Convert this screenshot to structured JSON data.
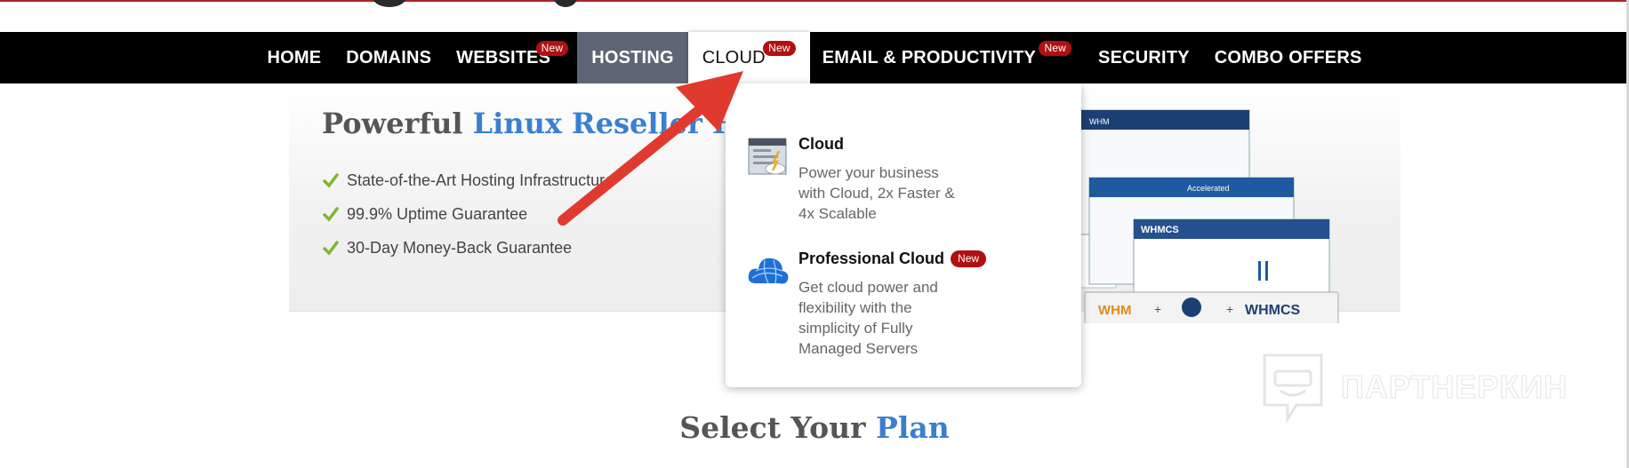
{
  "nav": {
    "items": [
      {
        "label": "HOME"
      },
      {
        "label": "DOMAINS"
      },
      {
        "label": "WEBSITES",
        "badge": "New"
      },
      {
        "label": "HOSTING"
      },
      {
        "label": "CLOUD",
        "badge": "New"
      },
      {
        "label": "EMAIL & PRODUCTIVITY",
        "badge": "New"
      },
      {
        "label": "SECURITY"
      },
      {
        "label": "COMBO OFFERS"
      }
    ]
  },
  "hero": {
    "title_plain": "Powerful ",
    "title_accent": "Linux Reseller Ho",
    "features": [
      "State-of-the-Art Hosting Infrastructure",
      "99.9% Uptime Guarantee",
      "30-Day Money-Back Guarantee"
    ],
    "brands": [
      "WHM",
      "WHMCS",
      "Accelerated",
      "WHMCS",
      "+",
      "+",
      "WHMCS"
    ]
  },
  "dropdown": {
    "items": [
      {
        "title": "Cloud",
        "description": "Power your business with Cloud, 2x Faster & 4x Scalable",
        "icon": "cloud-server-icon"
      },
      {
        "title": "Professional Cloud",
        "badge": "New",
        "description": "Get cloud power and flexibility with the simplicity of Fully Managed Servers",
        "icon": "blue-cloud-icon"
      }
    ]
  },
  "plans": {
    "title_plain": "Select Your ",
    "title_accent": "Plan"
  },
  "watermark": {
    "text": "ПАРТНЕРКИН"
  },
  "colors": {
    "nav_bg": "#000000",
    "hosting_bg": "#5e6676",
    "badge_red": "#b01010",
    "accent_blue": "#3a7fd0",
    "arrow_red": "#e03a2e"
  }
}
